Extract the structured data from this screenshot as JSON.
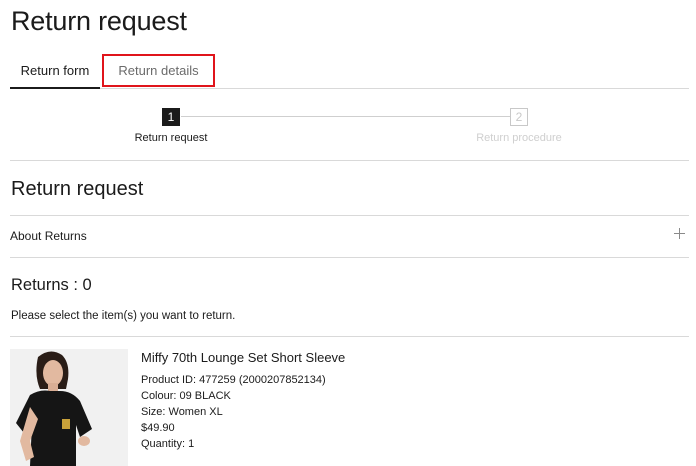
{
  "page": {
    "title": "Return request"
  },
  "tabs": [
    {
      "label": "Return form",
      "active": true
    },
    {
      "label": "Return details",
      "active": false,
      "highlighted": true
    }
  ],
  "steps": [
    {
      "number": "1",
      "label": "Return request",
      "state": "active"
    },
    {
      "number": "2",
      "label": "Return procedure",
      "state": "inactive"
    }
  ],
  "section": {
    "title": "Return request"
  },
  "about": {
    "label": "About Returns",
    "icon": "plus-icon"
  },
  "returns": {
    "count_label": "Returns : 0",
    "instruction": "Please select the item(s) you want to return."
  },
  "product": {
    "name": "Miffy 70th Lounge Set Short Sleeve",
    "product_id": "Product ID: 477259 (2000207852134)",
    "colour": "Colour: 09 BLACK",
    "size": "Size: Women XL",
    "price": "$49.90",
    "quantity": "Quantity: 1"
  },
  "colors": {
    "text": "#1b1b1b",
    "divider": "#d9d9d9",
    "highlight_border": "#e0141b",
    "inactive": "#cfcfcf"
  }
}
